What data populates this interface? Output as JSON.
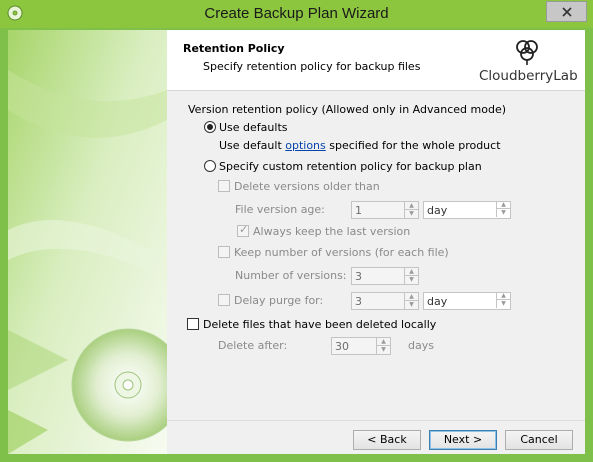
{
  "window": {
    "title": "Create Backup Plan Wizard",
    "close_label": "✕",
    "accent_color": "#8cc63f"
  },
  "header": {
    "title": "Retention Policy",
    "subtitle": "Specify retention policy for backup files",
    "logo_text": "CloudberryLab"
  },
  "retention": {
    "group_label": "Version retention policy (Allowed only in Advanced mode)",
    "use_defaults_label": "Use defaults",
    "use_defaults_selected": true,
    "defaults_note_prefix": "Use default ",
    "defaults_note_link": "options",
    "defaults_note_suffix": " specified for the whole product",
    "custom_label": "Specify custom retention policy for backup plan",
    "custom_selected": false,
    "delete_older_label": "Delete versions older than",
    "file_version_age_label": "File version age:",
    "file_version_age_value": "1",
    "file_version_age_unit": "day",
    "always_keep_label": "Always keep the last version",
    "keep_number_label": "Keep number of versions (for each file)",
    "number_of_versions_label": "Number of versions:",
    "number_of_versions_value": "3",
    "delay_purge_label": "Delay purge for:",
    "delay_purge_value": "3",
    "delay_purge_unit": "day"
  },
  "deleted_files": {
    "checkbox_label": "Delete files that have been deleted locally",
    "delete_after_label": "Delete after:",
    "delete_after_value": "30",
    "delete_after_unit": "days"
  },
  "buttons": {
    "back": "< Back",
    "next": "Next >",
    "cancel": "Cancel"
  },
  "icons": {
    "app": "cd-icon",
    "close": "close-icon",
    "logo": "cloudberry-logo-icon",
    "spinner": "spinner-arrows-icon",
    "dropdown": "dropdown-arrows-icon"
  }
}
